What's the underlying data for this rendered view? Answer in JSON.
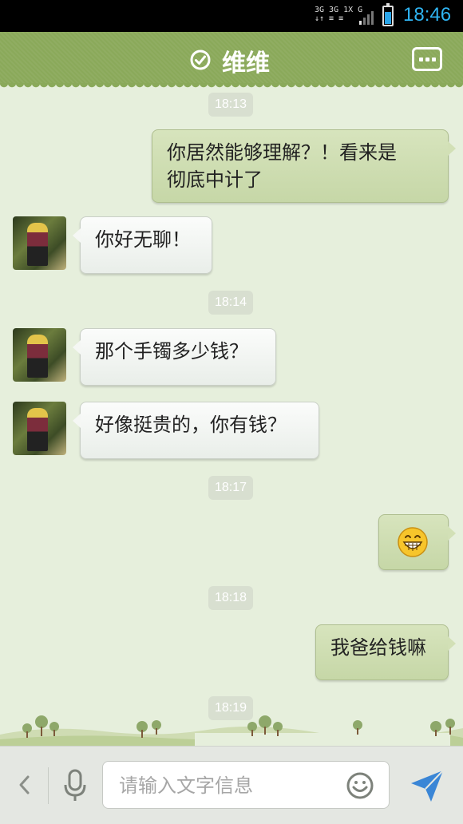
{
  "status_bar": {
    "network_top": "3G 3G 1X G",
    "network_bottom": "↓↑ ≡ ≡",
    "time": "18:46",
    "time_color": "#2fb4f2"
  },
  "header": {
    "contact_name": "维维",
    "verified_icon": "check-circle-icon",
    "menu_icon": "more-dots-icon"
  },
  "messages": {
    "ts1": "18:13",
    "m1": "你居然能够理解？！看来是",
    "m1b": "彻底中计了",
    "m2": "你好无聊！",
    "ts2": "18:14",
    "m3": "那个手镯多少钱？",
    "m4": "好像挺贵的，你有钱？",
    "ts3": "18:17",
    "m5_icon": "grin-emoji-icon",
    "ts4": "18:18",
    "m6": "我爸给钱嘛",
    "ts5": "18:19"
  },
  "composer": {
    "placeholder": "请输入文字信息",
    "back_icon": "chevron-left-icon",
    "voice_icon": "microphone-icon",
    "emoji_icon": "smiley-icon",
    "send_icon": "send-plane-icon",
    "accent": "#3a86d6"
  }
}
